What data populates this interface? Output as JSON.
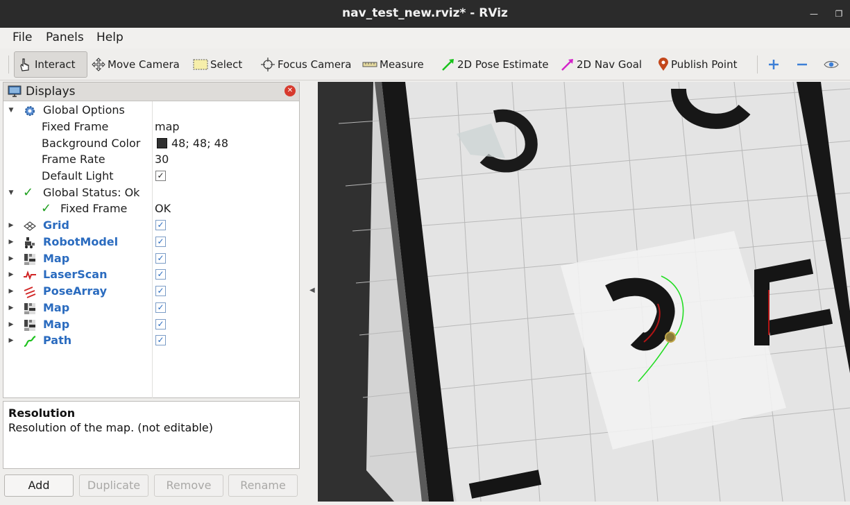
{
  "window": {
    "title": "nav_test_new.rviz* - RViz"
  },
  "menu": [
    {
      "label": "File"
    },
    {
      "label": "Panels"
    },
    {
      "label": "Help"
    }
  ],
  "toolbar": {
    "interact": "Interact",
    "move_camera": "Move Camera",
    "select": "Select",
    "focus_camera": "Focus Camera",
    "measure": "Measure",
    "pose_estimate": "2D Pose Estimate",
    "nav_goal": "2D Nav Goal",
    "publish_point": "Publish Point"
  },
  "displays": {
    "title": "Displays",
    "global_options": {
      "label": "Global Options",
      "fixed_frame_label": "Fixed Frame",
      "fixed_frame_value": "map",
      "bg_color_label": "Background Color",
      "bg_color_value": "48; 48; 48",
      "frame_rate_label": "Frame Rate",
      "frame_rate_value": "30",
      "default_light_label": "Default Light"
    },
    "global_status": {
      "label": "Global Status: Ok",
      "fixed_frame_label": "Fixed Frame",
      "fixed_frame_value": "OK"
    },
    "items": [
      {
        "label": "Grid",
        "icon": "grid-icon",
        "checked": true
      },
      {
        "label": "RobotModel",
        "icon": "robot-model-icon",
        "checked": true
      },
      {
        "label": "Map",
        "icon": "map-icon",
        "checked": true
      },
      {
        "label": "LaserScan",
        "icon": "laser-scan-icon",
        "checked": true
      },
      {
        "label": "PoseArray",
        "icon": "pose-array-icon",
        "checked": true
      },
      {
        "label": "Map",
        "icon": "map-icon",
        "checked": true
      },
      {
        "label": "Map",
        "icon": "map-icon",
        "checked": true
      },
      {
        "label": "Path",
        "icon": "path-icon",
        "checked": true
      }
    ]
  },
  "description": {
    "title": "Resolution",
    "text": "Resolution of the map. (not editable)"
  },
  "buttons": {
    "add": "Add",
    "duplicate": "Duplicate",
    "remove": "Remove",
    "rename": "Rename"
  },
  "colors": {
    "background": "#303030",
    "path": "#22dd22",
    "obstacle": "#151515"
  }
}
